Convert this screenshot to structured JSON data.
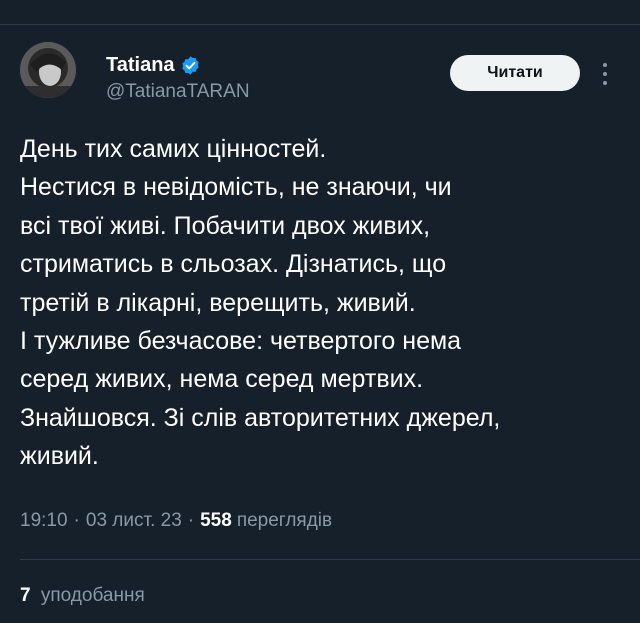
{
  "author": {
    "display_name": "Tatiana",
    "handle": "@TatianaTARAN",
    "verified_icon": "verified-badge-icon",
    "avatar_icon": "profile-photo"
  },
  "follow_button": {
    "label": "Читати"
  },
  "more_icon": "more-vertical-icon",
  "tweet": {
    "lines": [
      "День тих самих цінностей.",
      "Нестися в невідомість, не знаючи, чи",
      "всі твої живі. Побачити двох живих,",
      "стриматись в сльозах. Дізнатись, що",
      "третій в лікарні, верещить, живий.",
      "І тужливе безчасове: четвертого нема",
      "серед живих, нема серед мертвих.",
      "Знайшовся. Зі слів авторитетних джерел,",
      "живий."
    ]
  },
  "meta": {
    "time": "19:10",
    "date": "03 лист. 23",
    "separator": "·",
    "views_count": "558",
    "views_label": "переглядів"
  },
  "likes": {
    "count": "7",
    "label": "уподобання"
  },
  "colors": {
    "background": "#15202b",
    "text": "#ffffff",
    "secondary": "#8b98a5",
    "verified": "#1d9bf0",
    "button_bg": "#eff3f4"
  }
}
